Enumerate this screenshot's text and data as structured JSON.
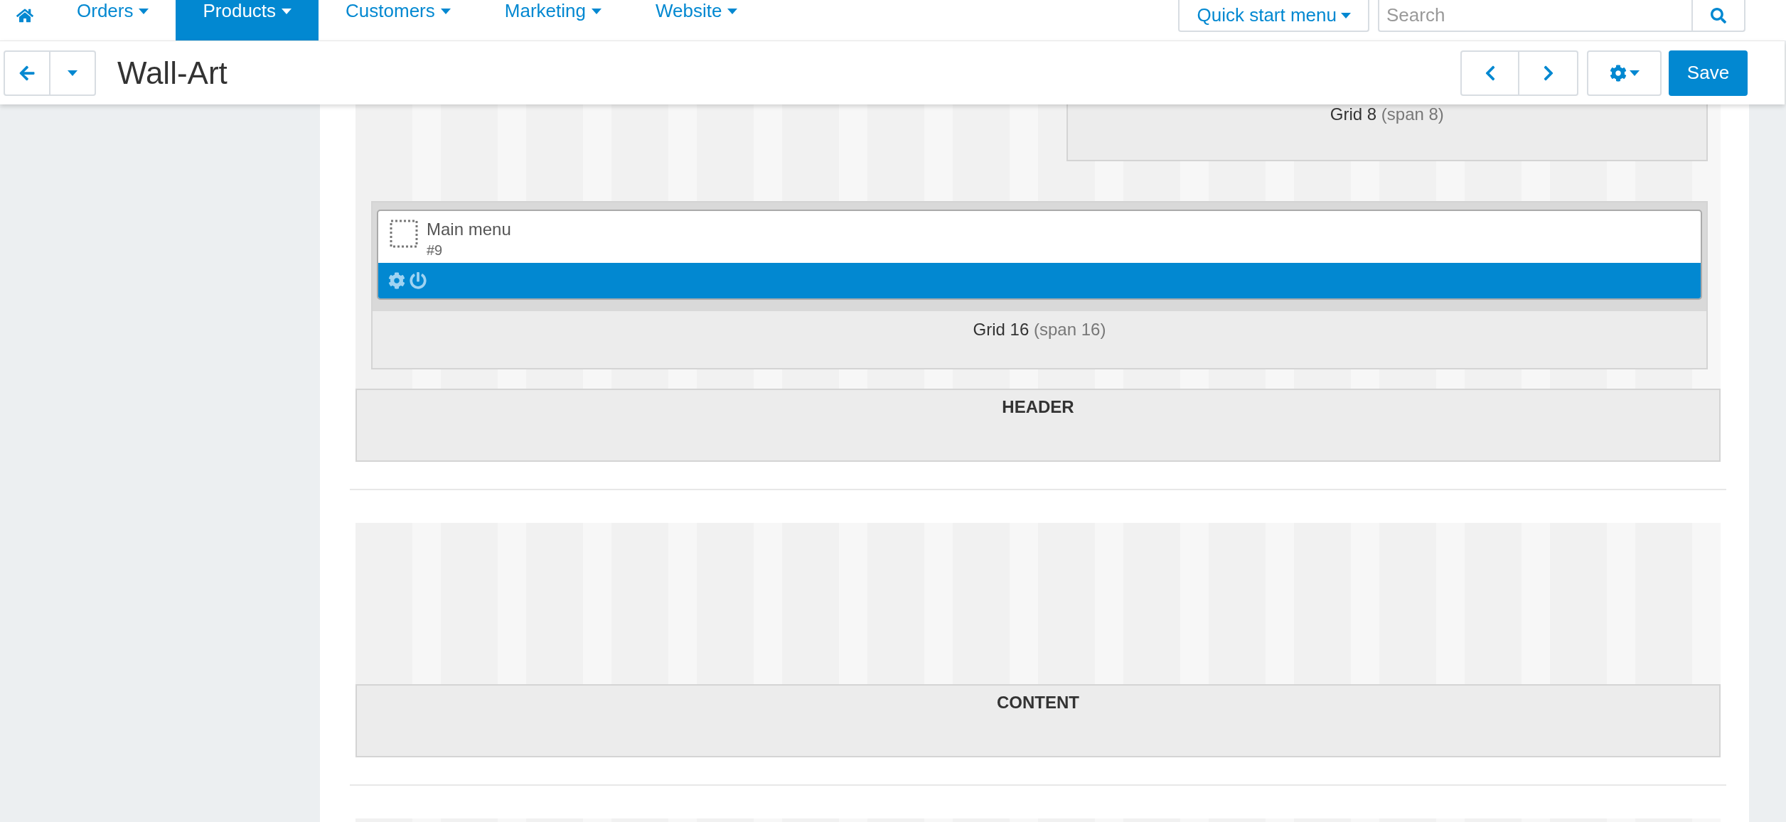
{
  "nav": {
    "items": [
      {
        "label": "Orders",
        "selected": false
      },
      {
        "label": "Products",
        "selected": true
      },
      {
        "label": "Customers",
        "selected": false
      },
      {
        "label": "Marketing",
        "selected": false
      },
      {
        "label": "Website",
        "selected": false
      }
    ]
  },
  "quick_start": {
    "label": "Quick start menu"
  },
  "search": {
    "placeholder": "Search"
  },
  "toolbar": {
    "title": "Wall-Art",
    "save": "Save"
  },
  "sections": [
    {
      "label": "HEADER",
      "blocks": [
        {
          "kind": "half",
          "name": "Grid 8",
          "span": "(span 8)"
        },
        {
          "kind": "full",
          "name": "Grid 16",
          "span": "(span 16)",
          "widgets": [
            {
              "title": "Main menu",
              "id": "#9"
            }
          ]
        }
      ]
    },
    {
      "label": "CONTENT"
    }
  ]
}
